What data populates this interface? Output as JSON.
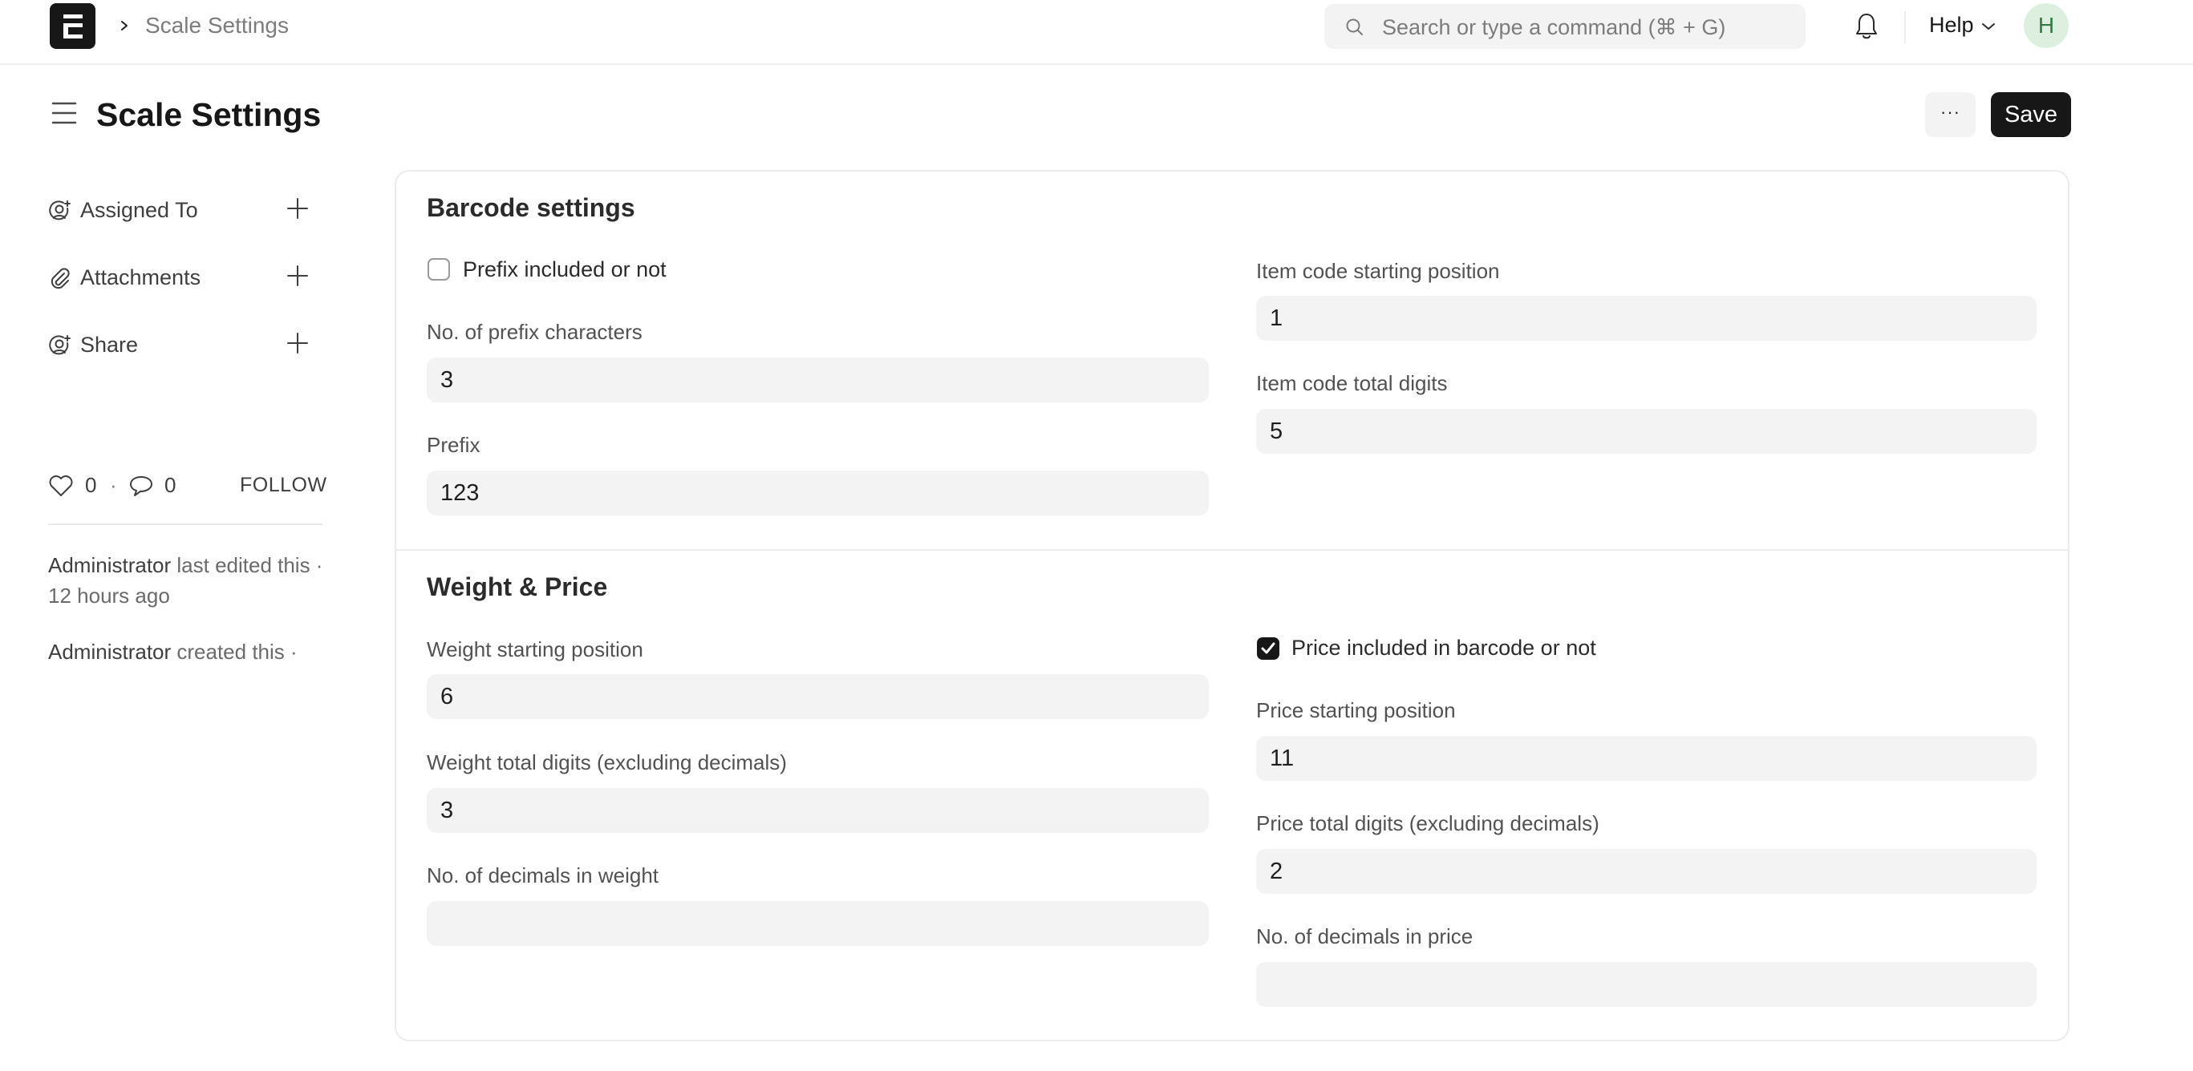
{
  "navbar": {
    "breadcrumb": "Scale Settings",
    "search_placeholder": "Search or type a command (⌘ + G)",
    "help_label": "Help",
    "avatar_initial": "H",
    "avatar_bg": "#ddefdf",
    "avatar_fg": "#317b42"
  },
  "page": {
    "title": "Scale Settings",
    "more_label": "···",
    "save_label": "Save"
  },
  "sidebar": {
    "items": [
      {
        "label": "Assigned To",
        "icon": "user-plus-icon"
      },
      {
        "label": "Attachments",
        "icon": "paperclip-icon"
      },
      {
        "label": "Share",
        "icon": "user-plus-icon"
      }
    ],
    "likes": "0",
    "separator": "·",
    "comments": "0",
    "follow_label": "FOLLOW",
    "activity": [
      {
        "user": "Administrator",
        "text": " last edited this · 12 hours ago"
      },
      {
        "user": "Administrator",
        "text": " created this ·"
      }
    ]
  },
  "form": {
    "barcode_section": {
      "title": "Barcode settings",
      "prefix_included": {
        "label": "Prefix included or not",
        "checked": false
      },
      "prefix_characters": {
        "label": "No. of prefix characters",
        "value": "3"
      },
      "prefix": {
        "label": "Prefix",
        "value": "123"
      },
      "item_code_start": {
        "label": "Item code starting position",
        "value": "1"
      },
      "item_code_digits": {
        "label": "Item code total digits",
        "value": "5"
      }
    },
    "weight_price_section": {
      "title": "Weight & Price",
      "weight_start": {
        "label": "Weight starting position",
        "value": "6"
      },
      "weight_digits": {
        "label": "Weight total digits (excluding decimals)",
        "value": "3"
      },
      "weight_decimals": {
        "label": "No. of decimals in weight",
        "value": ""
      },
      "price_included": {
        "label": "Price included in barcode or not",
        "checked": true
      },
      "price_start": {
        "label": "Price starting position",
        "value": "11"
      },
      "price_digits": {
        "label": "Price total digits (excluding decimals)",
        "value": "2"
      },
      "price_decimals": {
        "label": "No. of decimals in price",
        "value": ""
      }
    }
  }
}
